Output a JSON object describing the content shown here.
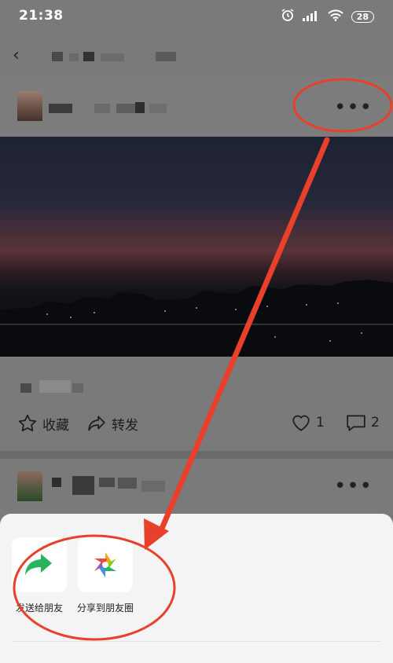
{
  "status": {
    "time": "21:38",
    "battery": "28"
  },
  "actions": {
    "favorite_label": "收藏",
    "forward_label": "转发",
    "like_count": "1",
    "comment_count": "2"
  },
  "share_sheet": {
    "items": [
      {
        "label": "发送给朋友",
        "icon": "share-arrow-icon"
      },
      {
        "label": "分享到朋友圈",
        "icon": "moments-aperture-icon"
      }
    ]
  },
  "colors": {
    "annotation_red": "#e8402b",
    "sheet_bg": "#f4f4f4",
    "overlay_bg": "#7a7a7a"
  }
}
